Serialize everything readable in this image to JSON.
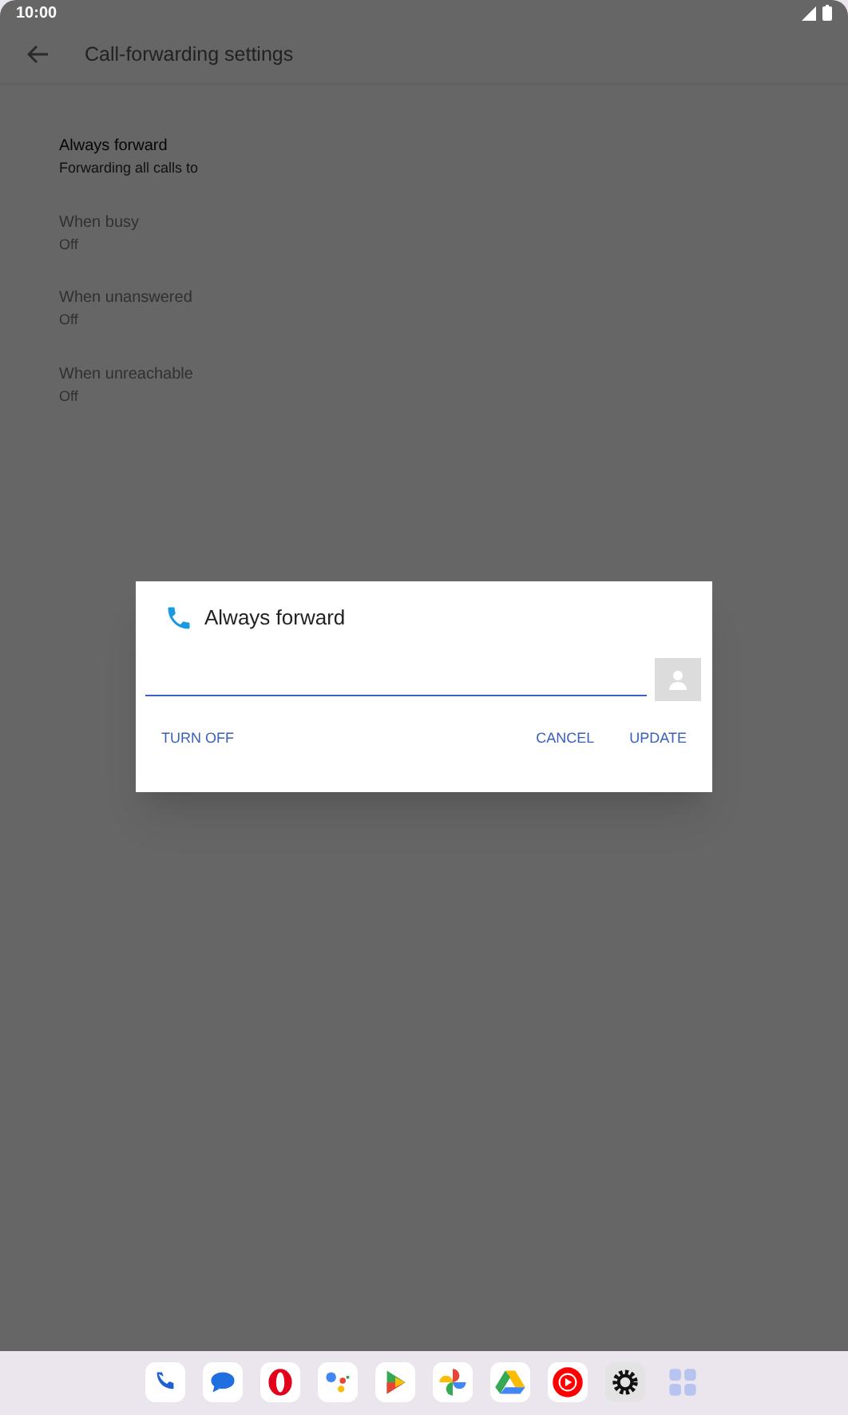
{
  "status_bar": {
    "time": "10:00"
  },
  "header": {
    "title": "Call-forwarding settings"
  },
  "settings": [
    {
      "title": "Always forward",
      "summary": "Forwarding all calls to",
      "disabled": false
    },
    {
      "title": "When busy",
      "summary": "Off",
      "disabled": true
    },
    {
      "title": "When unanswered",
      "summary": "Off",
      "disabled": true
    },
    {
      "title": "When unreachable",
      "summary": "Off",
      "disabled": true
    }
  ],
  "dialog": {
    "title": "Always forward",
    "buttons": [
      {
        "label": "TURN OFF"
      },
      {
        "label": "CANCEL"
      },
      {
        "label": "UPDATE"
      }
    ]
  }
}
